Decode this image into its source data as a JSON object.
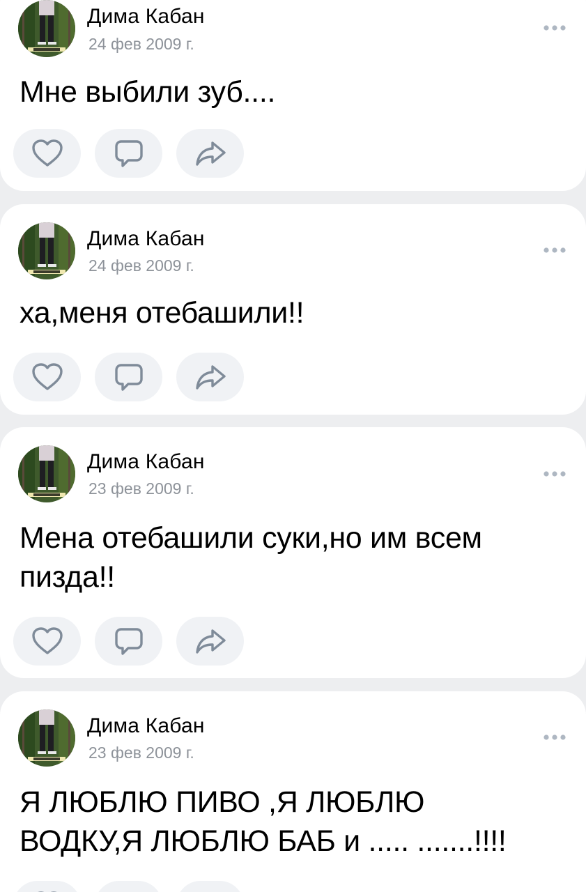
{
  "colors": {
    "background": "#edeef0",
    "card": "#ffffff",
    "secondary_text": "#8d9299",
    "icon": "#7f8b99",
    "action_bg": "#f0f2f5"
  },
  "posts": [
    {
      "author": "Дима Кабан",
      "date": "24 фев 2009 г.",
      "text": "Мне выбили зуб....",
      "icons": [
        "like-icon",
        "comment-icon",
        "share-icon"
      ]
    },
    {
      "author": "Дима Кабан",
      "date": "24 фев 2009 г.",
      "text": "ха,меня отебашили!!",
      "icons": [
        "like-icon",
        "comment-icon",
        "share-icon"
      ]
    },
    {
      "author": "Дима Кабан",
      "date": "23 фев 2009 г.",
      "text": "Мена отебашили суки,но им всем пизда!!",
      "icons": [
        "like-icon",
        "comment-icon",
        "share-icon"
      ]
    },
    {
      "author": "Дима Кабан",
      "date": "23 фев 2009 г.",
      "text": "Я ЛЮБЛЮ ПИВО ,Я ЛЮБЛЮ ВОДКУ,Я ЛЮБЛЮ БАБ и ..... .......!!!!",
      "icons": [
        "like-icon",
        "comment-icon",
        "share-icon"
      ]
    }
  ]
}
